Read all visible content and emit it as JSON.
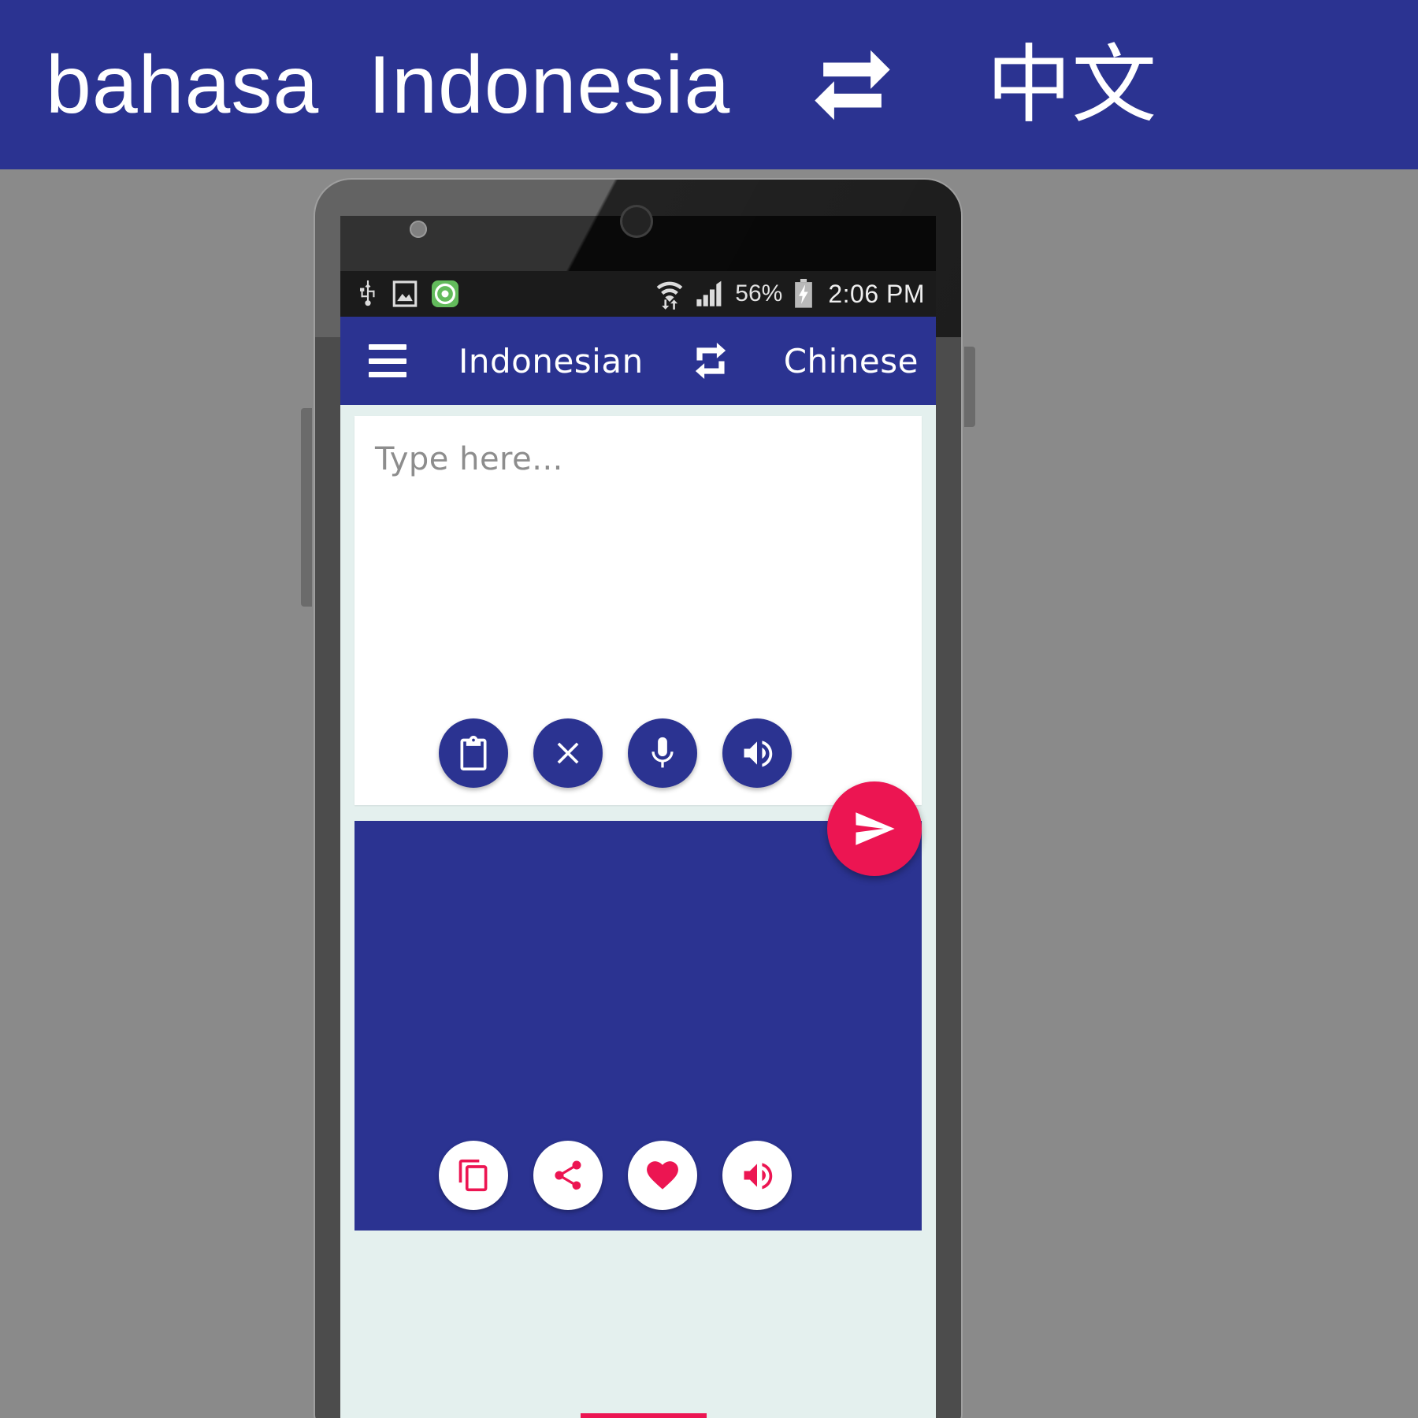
{
  "banner": {
    "source_language": "bahasa",
    "source_language_2": "Indonesia",
    "swap_icon": "swap-horizontal-icon",
    "target_language": "中文"
  },
  "phone": {
    "status_bar": {
      "icons": [
        "usb-icon",
        "screenshot-icon",
        "app-green-icon"
      ],
      "wifi_icon": "wifi-data-icon",
      "signal_icon": "cellular-signal-icon",
      "battery_percent": "56%",
      "battery_icon": "battery-charging-icon",
      "clock": "2:06 PM"
    },
    "toolbar": {
      "menu_icon": "hamburger-menu-icon",
      "source_language": "Indonesian",
      "swap_icon": "swap-languages-icon",
      "target_language": "Chinese"
    },
    "input_card": {
      "placeholder": "Type here...",
      "value": "",
      "actions": [
        {
          "name": "paste-button",
          "icon": "clipboard-icon",
          "style": "blue"
        },
        {
          "name": "clear-button",
          "icon": "close-x-icon",
          "style": "blue"
        },
        {
          "name": "voice-input-button",
          "icon": "microphone-icon",
          "style": "blue"
        },
        {
          "name": "speak-source-button",
          "icon": "speaker-icon",
          "style": "blue"
        }
      ]
    },
    "translate_button": {
      "icon": "send-icon",
      "color": "#ec1552"
    },
    "output_card": {
      "value": "",
      "background_color": "#2b3391",
      "actions": [
        {
          "name": "copy-button",
          "icon": "copy-icon",
          "style": "white"
        },
        {
          "name": "share-button",
          "icon": "share-icon",
          "style": "white"
        },
        {
          "name": "favorite-button",
          "icon": "heart-icon",
          "style": "white"
        },
        {
          "name": "speak-result-button",
          "icon": "speaker-icon",
          "style": "white"
        }
      ]
    }
  },
  "colors": {
    "brand_blue": "#2b3391",
    "accent_pink": "#ec1552",
    "page_background": "#8a8a8a",
    "screen_background": "#e4f0ee"
  }
}
